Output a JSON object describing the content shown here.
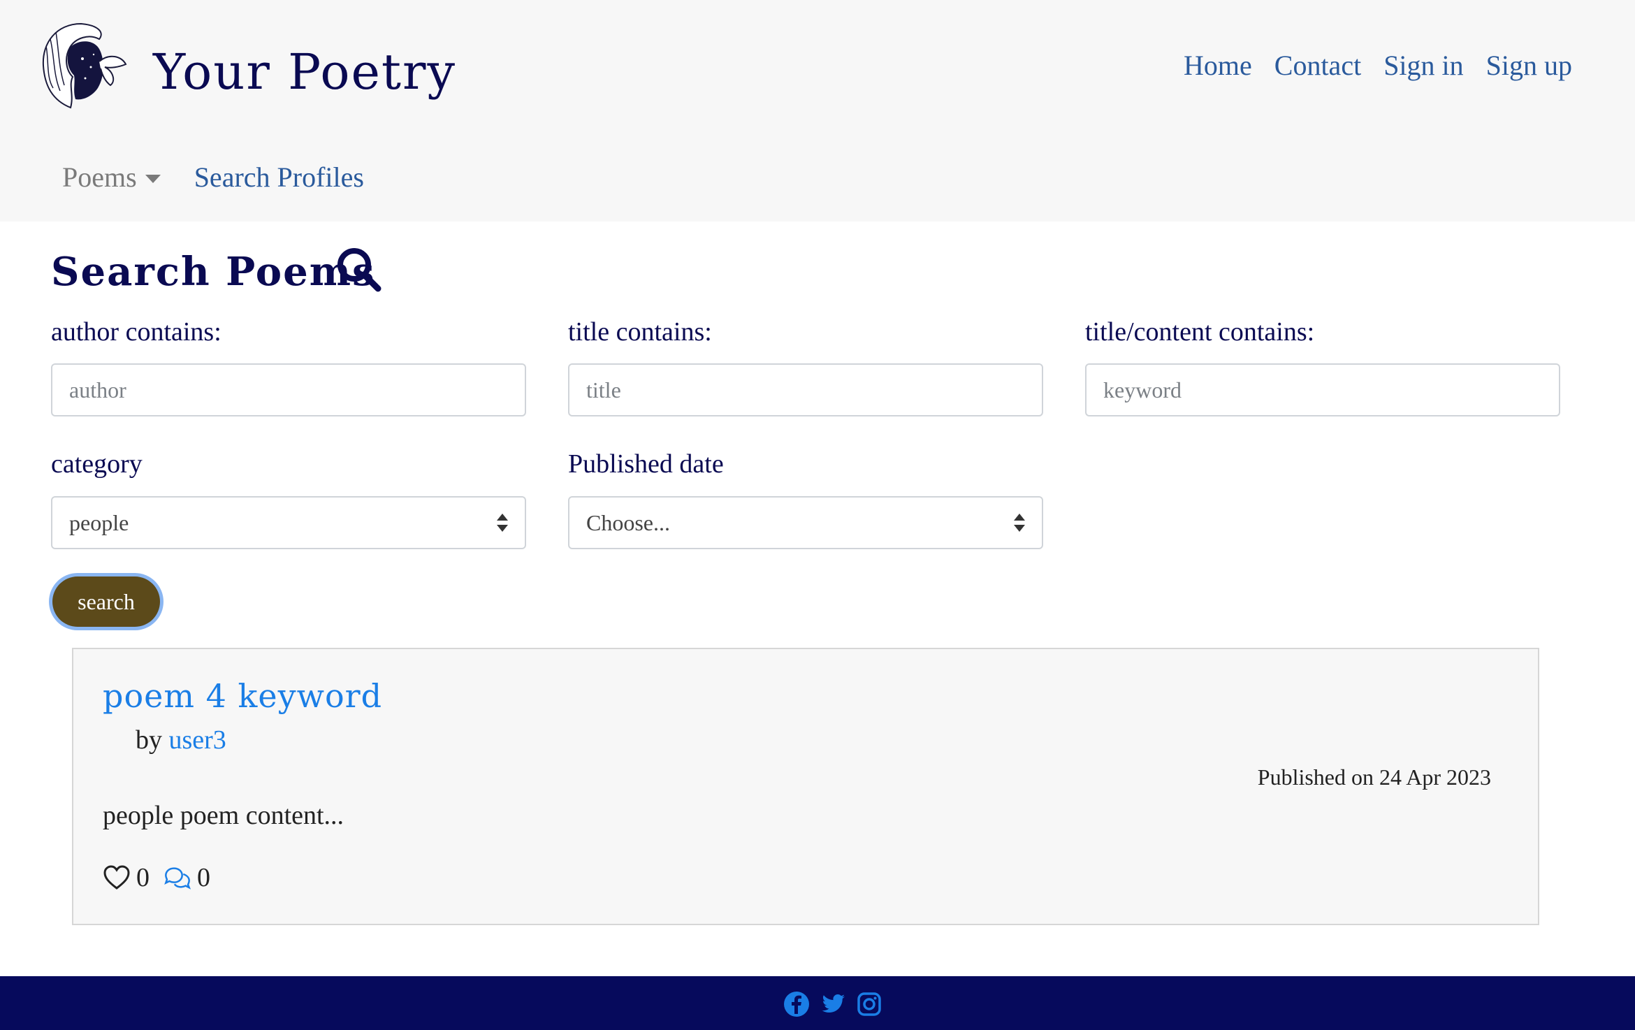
{
  "header": {
    "brand_title": "Your Poetry",
    "nav": [
      "Home",
      "Contact",
      "Sign in",
      "Sign up"
    ],
    "poems_dropdown": "Poems",
    "search_profiles": "Search Profiles"
  },
  "search": {
    "title": "Search Poems",
    "author_label": "author contains:",
    "author_placeholder": "author",
    "title_label": "title contains:",
    "title_placeholder": "title",
    "keyword_label": "title/content contains:",
    "keyword_placeholder": "keyword",
    "category_label": "category",
    "category_value": "people",
    "date_label": "Published date",
    "date_value": "Choose...",
    "button_label": "search"
  },
  "results": [
    {
      "title": "poem 4 keyword",
      "by": "by",
      "author": "user3",
      "published": "Published on 24 Apr 2023",
      "excerpt": "people poem content...",
      "likes": "0",
      "comments": "0"
    }
  ],
  "colors": {
    "brand": "#0a0a52",
    "link": "#2a5a9c",
    "accent_link": "#1a7ee6",
    "button": "#5c4a1a",
    "footer": "#060a5c"
  },
  "icons": {
    "logo": "woman-butterfly-logo",
    "search": "search-icon",
    "like": "heart-icon",
    "comment": "comments-icon",
    "social": [
      "facebook-icon",
      "twitter-icon",
      "instagram-icon"
    ]
  }
}
